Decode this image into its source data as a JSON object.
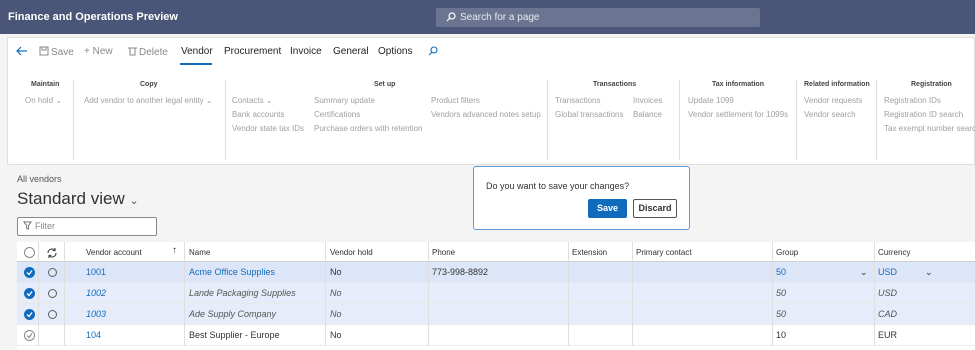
{
  "app": {
    "title": "Finance and Operations Preview",
    "search_placeholder": "Search for a page"
  },
  "toolbar": {
    "save": "Save",
    "new": "New",
    "delete": "Delete",
    "tabs": [
      "Vendor",
      "Procurement",
      "Invoice",
      "General",
      "Options"
    ]
  },
  "ribbon": {
    "groups": {
      "maintain": "Maintain",
      "copy": "Copy",
      "setup": "Set up",
      "transactions": "Transactions",
      "tax": "Tax information",
      "related": "Related information",
      "registration": "Registration"
    },
    "items": {
      "on_hold": "On hold",
      "add_vendor": "Add vendor to another legal entity",
      "contacts": "Contacts",
      "bank_accounts": "Bank accounts",
      "vendor_state_tax_ids": "Vendor state tax IDs",
      "summary_update": "Summary update",
      "certifications": "Certifications",
      "purchase_orders_retention": "Purchase orders with retention",
      "product_filters": "Product filters",
      "vendors_advanced_notes_setup": "Vendors advanced notes setup",
      "transactions": "Transactions",
      "global_transactions": "Global transactions",
      "invoices": "Invoices",
      "balance": "Balance",
      "update_1099": "Update 1099",
      "vendor_settlement_1099s": "Vendor settlement for 1099s",
      "vendor_requests": "Vendor requests",
      "vendor_search": "Vendor search",
      "registration_ids": "Registration IDs",
      "registration_id_search": "Registration ID search",
      "tax_exempt_number_search": "Tax exempt number search"
    }
  },
  "page": {
    "breadcrumb": "All vendors",
    "view_title": "Standard view",
    "filter_placeholder": "Filter"
  },
  "dialog": {
    "message": "Do you want to save your changes?",
    "save": "Save",
    "discard": "Discard"
  },
  "grid": {
    "headers": {
      "account": "Vendor account",
      "name": "Name",
      "hold": "Vendor hold",
      "phone": "Phone",
      "extension": "Extension",
      "contact": "Primary contact",
      "group": "Group",
      "currency": "Currency"
    },
    "rows": [
      {
        "account": "1001",
        "name": "Acme Office Supplies",
        "hold": "No",
        "phone": "773-998-8892",
        "group": "50",
        "currency": "USD",
        "selected": true
      },
      {
        "account": "1002",
        "name": "Lande Packaging Supplies",
        "hold": "No",
        "phone": "",
        "group": "50",
        "currency": "USD",
        "selected": true
      },
      {
        "account": "1003",
        "name": "Ade Supply Company",
        "hold": "No",
        "phone": "",
        "group": "50",
        "currency": "CAD",
        "selected": true
      },
      {
        "account": "104",
        "name": "Best Supplier - Europe",
        "hold": "No",
        "phone": "",
        "group": "10",
        "currency": "EUR",
        "selected": false
      }
    ]
  },
  "colors": {
    "topbar": "#4a5678",
    "accent": "#0f6cbd",
    "selected_row": "#dde6f8"
  }
}
